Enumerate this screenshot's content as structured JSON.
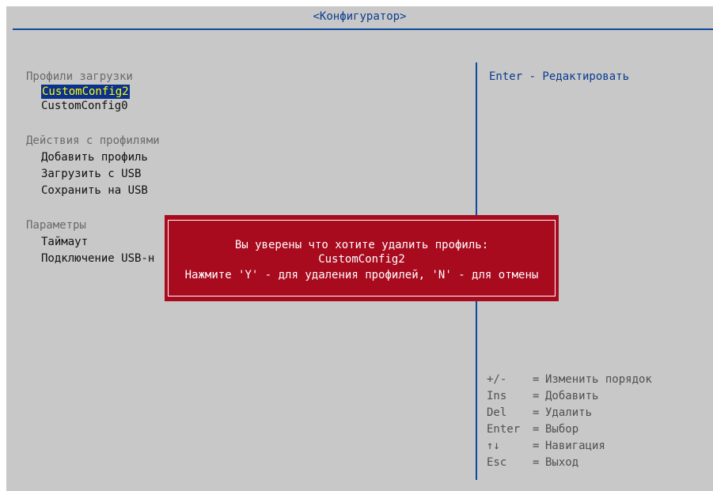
{
  "title": "<Конфигуратор>",
  "sections": [
    {
      "heading": "Профили загрузки",
      "items": [
        "CustomConfig2",
        "CustomConfig0"
      ]
    },
    {
      "heading": "Действия с профилями",
      "items": [
        "Добавить профиль",
        "Загрузить с USB",
        "Сохранить на USB"
      ]
    },
    {
      "heading": "Параметры",
      "items": [
        "Таймаут",
        "Подключение USB-н"
      ]
    }
  ],
  "selected_item": "CustomConfig2",
  "help_text": "Enter - Редактировать",
  "key_legend": [
    {
      "key": "+/-",
      "action": "Изменить порядок"
    },
    {
      "key": "Ins",
      "action": "Добавить"
    },
    {
      "key": "Del",
      "action": "Удалить"
    },
    {
      "key": "Enter",
      "action": "Выбор"
    },
    {
      "key": "↑↓",
      "action": "Навигация"
    },
    {
      "key": "Esc",
      "action": "Выход"
    }
  ],
  "dialog": {
    "line1": "Вы уверены что хотите удалить профиль:",
    "line2": "CustomConfig2",
    "line3": "Нажмите 'Y' - для удаления профилей, 'N' - для отмены"
  },
  "colors": {
    "background": "#c8c8c8",
    "accent": "#0b3c8f",
    "selection_bg": "#0a318e",
    "selection_fg": "#ffff00",
    "dialog_bg": "#a80a1e"
  }
}
